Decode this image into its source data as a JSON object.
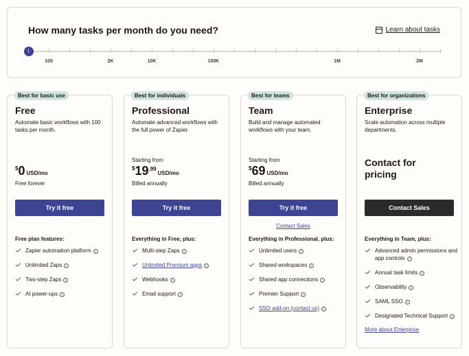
{
  "tasks": {
    "title": "How many tasks per month do you need?",
    "learn_label": "Learn about tasks",
    "tick_labels": [
      "100",
      "2K",
      "10K",
      "100K",
      "1M",
      "2M"
    ],
    "selected_index": 0
  },
  "colors": {
    "accent": "#3d4592",
    "badge_bg": "#cfe5df",
    "dark_button": "#2b2b2b",
    "check": "#2e7a62"
  },
  "plans": [
    {
      "badge": "Best for basic use",
      "name": "Free",
      "description": "Automate basic workflows with 100 tasks per month.",
      "starting": "",
      "currency": "$",
      "amount": "0",
      "cents": "",
      "unit": "USD/mo",
      "billing": "Free forever",
      "cta": "Try it free",
      "features_title": "Free plan features:",
      "features": [
        {
          "label": "Zapier automation platform",
          "link": false
        },
        {
          "label": "Unlimited Zaps",
          "link": false
        },
        {
          "label": "Two-step Zaps",
          "link": false
        },
        {
          "label": "AI power-ups",
          "link": false
        }
      ]
    },
    {
      "badge": "Best for individuals",
      "name": "Professional",
      "description": "Automate advanced workflows with the full power of Zapier.",
      "starting": "Starting from",
      "currency": "$",
      "amount": "19",
      "cents": ".99",
      "unit": "USD/mo",
      "billing": "Billed annually",
      "cta": "Try it free",
      "features_title": "Everything in Free, plus:",
      "features": [
        {
          "label": "Multi-step Zaps",
          "link": false
        },
        {
          "label": "Unlimited Premium apps",
          "link": true
        },
        {
          "label": "Webhooks",
          "link": false
        },
        {
          "label": "Email support",
          "link": false
        }
      ]
    },
    {
      "badge": "Best for teams",
      "name": "Team",
      "description": "Build and manage automated workflows with your team.",
      "starting": "Starting from",
      "currency": "$",
      "amount": "69",
      "cents": "",
      "unit": "USD/mo",
      "billing": "Billed annually",
      "cta": "Try it free",
      "contact_sales": "Contact Sales",
      "features_title": "Everything in Professional, plus:",
      "features": [
        {
          "label": "Unlimited users",
          "link": false
        },
        {
          "label": "Shared workspaces",
          "link": false
        },
        {
          "label": "Shared app connections",
          "link": false
        },
        {
          "label": "Premier Support",
          "link": false
        },
        {
          "label": "SSO add-on (contact us)",
          "link": true
        }
      ]
    },
    {
      "badge": "Best for organizations",
      "name": "Enterprise",
      "description": "Scale automation across multiple departments.",
      "contact_price": "Contact for pricing",
      "cta": "Contact Sales",
      "features_title": "Everything in Team, plus:",
      "features": [
        {
          "label": "Advanced admin permissions and app controls",
          "link": false
        },
        {
          "label": "Annual task limits",
          "link": false
        },
        {
          "label": "Observability",
          "link": false
        },
        {
          "label": "SAML SSO",
          "link": false
        },
        {
          "label": "Designated Technical Support",
          "link": false
        }
      ],
      "more_link": "More about Enterprise"
    }
  ]
}
